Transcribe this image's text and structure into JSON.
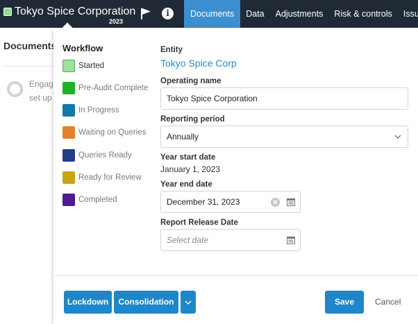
{
  "header": {
    "entity_name": "Tokyo Spice Corporation",
    "entity_year": "2023",
    "status_color": "#8fdc8f",
    "icons": [
      "flag-icon",
      "info-icon"
    ],
    "nav": [
      {
        "label": "Documents",
        "active": true
      },
      {
        "label": "Data",
        "active": false
      },
      {
        "label": "Adjustments",
        "active": false
      },
      {
        "label": "Risk & controls",
        "active": false
      },
      {
        "label": "Issues",
        "active": false
      }
    ]
  },
  "background": {
    "title": "Documents",
    "text": "Engagement set up"
  },
  "workflow": {
    "heading": "Workflow",
    "items": [
      {
        "label": "Started",
        "color": "#9be29b",
        "current": true
      },
      {
        "label": "Pre-Audit Complete",
        "color": "#22b02c",
        "current": false
      },
      {
        "label": "In Progress",
        "color": "#1479a8",
        "current": false
      },
      {
        "label": "Waiting on Queries",
        "color": "#e3832a",
        "current": false
      },
      {
        "label": "Queries Ready",
        "color": "#243d85",
        "current": false
      },
      {
        "label": "Ready for Review",
        "color": "#c9a413",
        "current": false
      },
      {
        "label": "Completed",
        "color": "#4f1a92",
        "current": false
      }
    ]
  },
  "form": {
    "entity_label": "Entity",
    "entity_value": "Tokyo Spice Corp",
    "operating_name_label": "Operating name",
    "operating_name_value": "Tokyo Spice Corporation",
    "reporting_period_label": "Reporting period",
    "reporting_period_value": "Annually",
    "year_start_label": "Year start date",
    "year_start_value": "January 1, 2023",
    "year_end_label": "Year end date",
    "year_end_value": "December 31, 2023",
    "release_label": "Report Release Date",
    "release_placeholder": "Select date"
  },
  "footer": {
    "lockdown_label": "Lockdown",
    "consolidation_label": "Consolidation",
    "save_label": "Save",
    "cancel_label": "Cancel"
  }
}
